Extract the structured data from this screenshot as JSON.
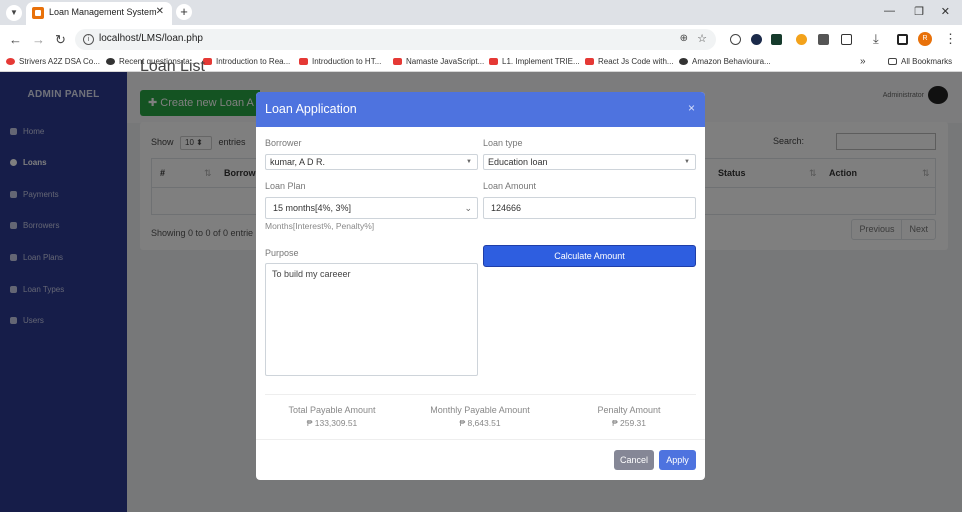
{
  "browser": {
    "tab_title": "Loan Management System",
    "url": "localhost/LMS/loan.php",
    "profile_initial": "R",
    "bookmarks": [
      "Strivers A2Z DSA Co...",
      "Recent questions ta...",
      "Introduction to Rea...",
      "Introduction to HT...",
      "Namaste JavaScript...",
      "L1. Implement TRIE...",
      "React Js Code with...",
      "Amazon Behavioura..."
    ],
    "all_bookmarks": "All Bookmarks",
    "colors": {
      "tabbar": "#dee1e6"
    }
  },
  "sidebar": {
    "brand": "ADMIN PANEL",
    "items": [
      {
        "label": "Home",
        "icon": "home-icon"
      },
      {
        "label": "Loans",
        "icon": "coins-icon",
        "active": true
      },
      {
        "label": "Payments",
        "icon": "money-icon"
      },
      {
        "label": "Borrowers",
        "icon": "id-card-icon"
      },
      {
        "label": "Loan Plans",
        "icon": "list-icon"
      },
      {
        "label": "Loan Types",
        "icon": "table-icon"
      },
      {
        "label": "Users",
        "icon": "user-icon"
      }
    ]
  },
  "topbar": {
    "user": "Administrator"
  },
  "page": {
    "title": "Loan List",
    "create_button": "Create new Loan A",
    "show_label": "Show",
    "entries_value": "10",
    "entries_label": "entries",
    "search_label": "Search:",
    "columns": [
      "#",
      "Borrowe",
      "Status",
      "Action"
    ],
    "info": "Showing 0 to 0 of 0 entrie",
    "previous": "Previous",
    "next": "Next"
  },
  "modal": {
    "title": "Loan Application",
    "close": "×",
    "borrower_label": "Borrower",
    "borrower_value": "kumar, A D R.",
    "loan_type_label": "Loan type",
    "loan_type_value": "Education loan",
    "loan_plan_label": "Loan Plan",
    "loan_plan_value": "15 months[4%, 3%]",
    "loan_plan_help": "Months[Interest%, Penalty%]",
    "amount_label": "Loan Amount",
    "amount_value": "124666",
    "purpose_label": "Purpose",
    "purpose_value": "To build my careeer",
    "calculate_button": "Calculate Amount",
    "summary": [
      {
        "label": "Total Payable Amount",
        "value": "₱ 133,309.51"
      },
      {
        "label": "Monthly Payable Amount",
        "value": "₱ 8,643.51"
      },
      {
        "label": "Penalty Amount",
        "value": "₱ 259.31"
      }
    ],
    "cancel_button": "Cancel",
    "apply_button": "Apply",
    "colors": {
      "header": "#4e73df",
      "primary": "#2e5ee0",
      "cancel": "#858796"
    }
  }
}
